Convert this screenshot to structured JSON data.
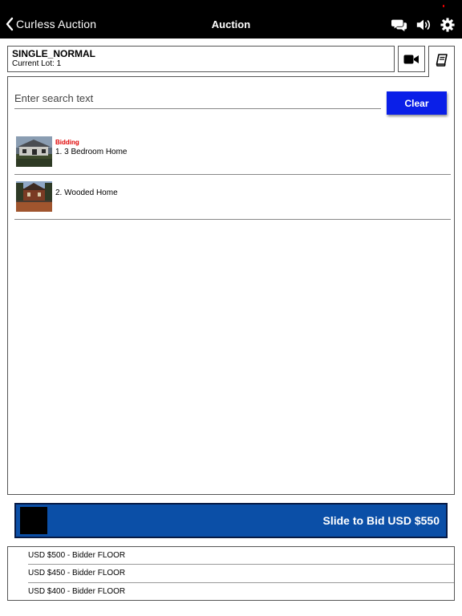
{
  "nav": {
    "back_label": "Curless Auction",
    "title": "Auction",
    "icons": [
      "chat-icon",
      "speaker-icon",
      "gear-icon"
    ]
  },
  "lot_header": {
    "name": "SINGLE_NORMAL",
    "current_lot": "Current Lot: 1"
  },
  "search": {
    "placeholder": "Enter search text",
    "value": "",
    "clear_label": "Clear"
  },
  "lots": [
    {
      "status": "Bidding",
      "title": "1. 3 Bedroom Home"
    },
    {
      "status": "",
      "title": "2. Wooded Home"
    }
  ],
  "slider": {
    "label": "Slide to Bid USD $550"
  },
  "bid_history": [
    "USD $500 - Bidder FLOOR",
    "USD $450 - Bidder FLOOR",
    "USD $400 - Bidder FLOOR"
  ],
  "colors": {
    "nav_bg": "#000000",
    "clear_button": "#0a1fe8",
    "slider_bg": "#0b4fa7",
    "bidding_status": "#e00000"
  }
}
